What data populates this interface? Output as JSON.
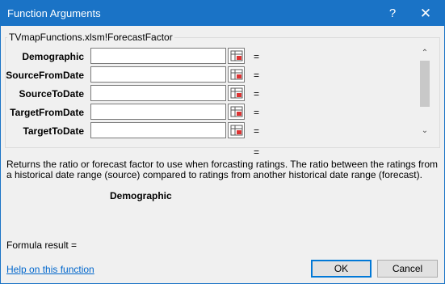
{
  "window": {
    "title": "Function Arguments",
    "help_glyph": "?",
    "close_glyph": "✕"
  },
  "group": {
    "label": "TVmapFunctions.xlsm!ForecastFactor"
  },
  "arguments": [
    {
      "label": "Demographic",
      "value": "",
      "equals": "="
    },
    {
      "label": "SourceFromDate",
      "value": "",
      "equals": "="
    },
    {
      "label": "SourceToDate",
      "value": "",
      "equals": "="
    },
    {
      "label": "TargetFromDate",
      "value": "",
      "equals": "="
    },
    {
      "label": "TargetToDate",
      "value": "",
      "equals": "="
    }
  ],
  "scroll": {
    "up_glyph": "⌃",
    "down_glyph": "⌄"
  },
  "result_equals": "=",
  "description": "Returns the ratio or forecast factor to use when forcasting ratings. The ratio between the ratings from a historical date range (source) compared to ratings from another historical date range (forecast).",
  "current_argument": "Demographic",
  "formula_result_label": "Formula result =",
  "help_link": "Help on this function",
  "buttons": {
    "ok": "OK",
    "cancel": "Cancel"
  },
  "colors": {
    "titlebar": "#1a73c6",
    "link": "#0066cc",
    "ok_border": "#0078d7"
  }
}
